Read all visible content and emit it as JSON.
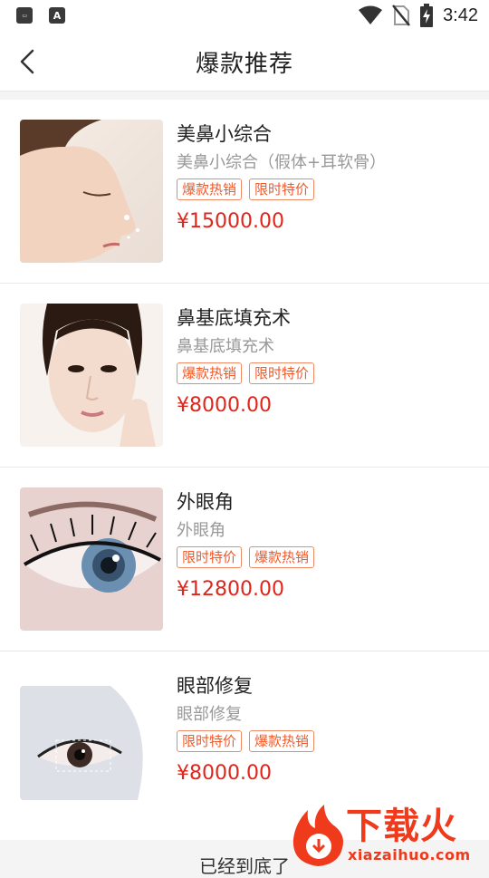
{
  "status_bar": {
    "time": "3:42",
    "left_icons": [
      "app-notification-icon",
      "a-app-icon"
    ],
    "right_icons": [
      "wifi-icon",
      "no-sim-icon",
      "battery-charging-icon"
    ]
  },
  "header": {
    "title": "爆款推荐",
    "back_icon": "chevron-left-icon"
  },
  "items": [
    {
      "title": "美鼻小综合",
      "subtitle": "美鼻小综合（假体+耳软骨）",
      "tags": [
        "爆款热销",
        "限时特价"
      ],
      "price": "¥15000.00",
      "image": "nose-profile-photo"
    },
    {
      "title": "鼻基底填充术",
      "subtitle": "鼻基底填充术",
      "tags": [
        "爆款热销",
        "限时特价"
      ],
      "price": "¥8000.00",
      "image": "face-portrait-photo"
    },
    {
      "title": "外眼角",
      "subtitle": "外眼角",
      "tags": [
        "限时特价",
        "爆款热销"
      ],
      "price": "¥12800.00",
      "image": "eye-closeup-photo"
    },
    {
      "title": "眼部修复",
      "subtitle": "眼部修复",
      "tags": [
        "限时特价",
        "爆款热销"
      ],
      "price": "¥8000.00",
      "image": "eye-repair-photo"
    }
  ],
  "footer": {
    "end_text": "已经到底了"
  },
  "watermark": {
    "cn": "下载火",
    "en": "xiazaihuo.com"
  },
  "colors": {
    "accent_red": "#e0251b",
    "tag_orange": "#f15a2b",
    "watermark_red": "#ef3a1c"
  }
}
